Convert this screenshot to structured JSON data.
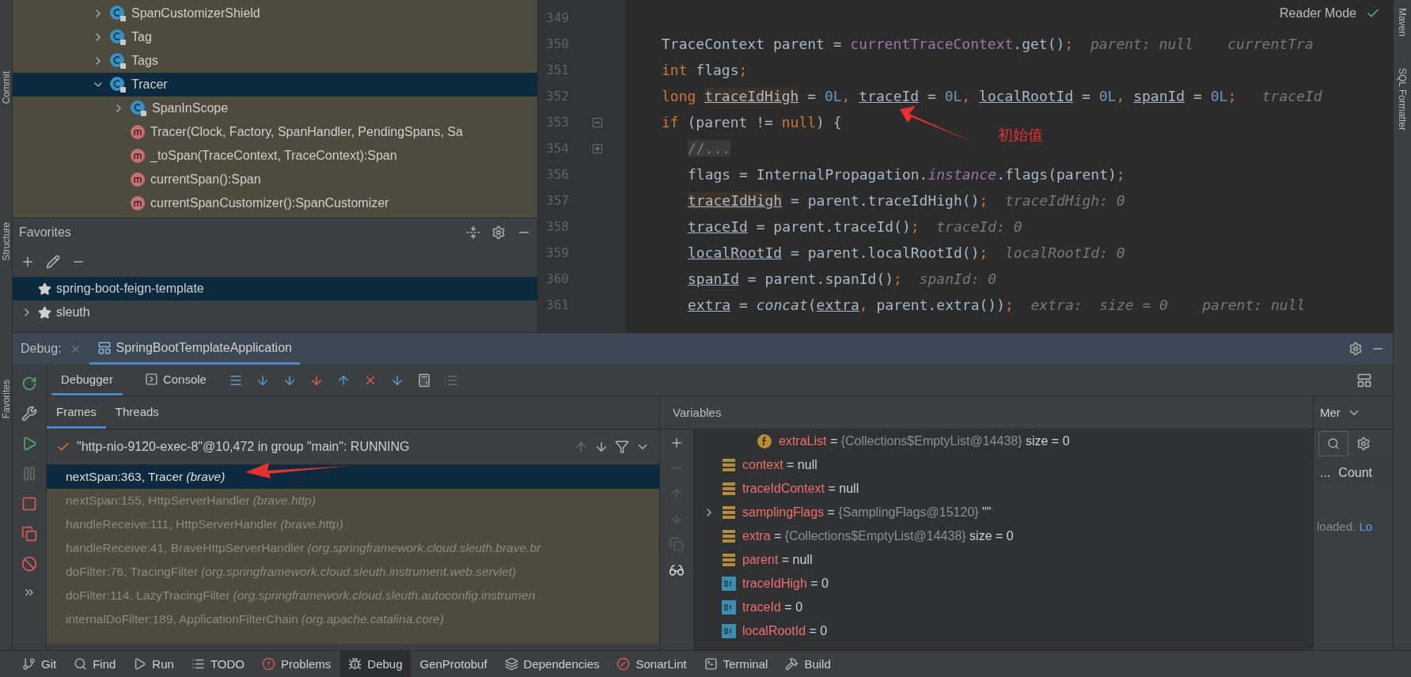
{
  "left_strip": [
    "Commit",
    "Structure",
    "Favorites"
  ],
  "right_strip": [
    "Maven",
    "SQL Formatter"
  ],
  "project_tree": [
    {
      "label": "SpanCustomizerShield",
      "kind": "class",
      "expanded": false,
      "selected": false
    },
    {
      "label": "Tag",
      "kind": "class",
      "expanded": false,
      "selected": false
    },
    {
      "label": "Tags",
      "kind": "class",
      "expanded": false,
      "selected": false
    },
    {
      "label": "Tracer",
      "kind": "class",
      "expanded": true,
      "selected": true,
      "children": [
        {
          "label": "SpanInScope",
          "kind": "class",
          "expanded": false,
          "selected": false
        },
        {
          "label": "Tracer(Clock, Factory, SpanHandler, PendingSpans, Sa",
          "kind": "method",
          "selected": false
        },
        {
          "label": "_toSpan(TraceContext, TraceContext):Span",
          "kind": "method",
          "selected": false
        },
        {
          "label": "currentSpan():Span",
          "kind": "method",
          "selected": false
        },
        {
          "label": "currentSpanCustomizer():SpanCustomizer",
          "kind": "method",
          "selected": false
        }
      ]
    }
  ],
  "favorites": {
    "title": "Favorites",
    "items": [
      {
        "label": "spring-boot-feign-template",
        "expandable": false,
        "selected": true
      },
      {
        "label": "sleuth",
        "expandable": true,
        "selected": false
      }
    ]
  },
  "editor": {
    "reader_mode": "Reader Mode",
    "annotation": "初始值",
    "lines": [
      {
        "number": "349"
      },
      {
        "number": "350",
        "tokens": [
          {
            "text": "TraceContext parent = ",
            "kind": "plain"
          },
          {
            "text": "currentTraceContext",
            "kind": "field"
          },
          {
            "text": ".get()",
            "kind": "plain"
          },
          {
            "text": ";",
            "kind": "punct"
          },
          {
            "text": "  parent: null    currentTra",
            "kind": "hint"
          }
        ]
      },
      {
        "number": "351",
        "tokens": [
          {
            "text": "int",
            "kind": "keyword"
          },
          {
            "text": " flags",
            "kind": "plain"
          },
          {
            "text": ";",
            "kind": "punct"
          }
        ]
      },
      {
        "number": "352",
        "tokens": [
          {
            "text": "long ",
            "kind": "keyword"
          },
          {
            "text": "traceIdHigh",
            "kind": "varhl"
          },
          {
            "text": " = ",
            "kind": "plain"
          },
          {
            "text": "0L",
            "kind": "number"
          },
          {
            "text": ", ",
            "kind": "punct"
          },
          {
            "text": "traceId",
            "kind": "var"
          },
          {
            "text": " = ",
            "kind": "plain"
          },
          {
            "text": "0L",
            "kind": "number"
          },
          {
            "text": ", ",
            "kind": "punct"
          },
          {
            "text": "localRootId",
            "kind": "var"
          },
          {
            "text": " = ",
            "kind": "plain"
          },
          {
            "text": "0L",
            "kind": "number"
          },
          {
            "text": ", ",
            "kind": "punct"
          },
          {
            "text": "spanId",
            "kind": "var"
          },
          {
            "text": " = ",
            "kind": "plain"
          },
          {
            "text": "0L",
            "kind": "number"
          },
          {
            "text": ";",
            "kind": "punct"
          },
          {
            "text": "   traceId",
            "kind": "hint"
          }
        ]
      },
      {
        "number": "353",
        "collapsed": false,
        "tokens": [
          {
            "text": "if",
            "kind": "keyword"
          },
          {
            "text": " (parent != ",
            "kind": "plain"
          },
          {
            "text": "null",
            "kind": "keyword"
          },
          {
            "text": ") {",
            "kind": "plain"
          }
        ]
      },
      {
        "number": "354",
        "collapsed": true,
        "inner": true,
        "tokens": [
          {
            "text": "//...",
            "kind": "folded"
          }
        ]
      },
      {
        "number": "356",
        "inner": true,
        "tokens": [
          {
            "text": "flags = InternalPropagation.",
            "kind": "plain"
          },
          {
            "text": "instance",
            "kind": "static"
          },
          {
            "text": ".flags(parent)",
            "kind": "plain"
          },
          {
            "text": ";",
            "kind": "punct"
          }
        ]
      },
      {
        "number": "357",
        "inner": true,
        "tokens": [
          {
            "text": "traceIdHigh",
            "kind": "varhl"
          },
          {
            "text": " = parent.traceIdHigh()",
            "kind": "plain"
          },
          {
            "text": ";",
            "kind": "punct"
          },
          {
            "text": "  traceIdHigh: 0",
            "kind": "hint"
          }
        ]
      },
      {
        "number": "358",
        "inner": true,
        "tokens": [
          {
            "text": "traceId",
            "kind": "var"
          },
          {
            "text": " = parent.traceId()",
            "kind": "plain"
          },
          {
            "text": ";",
            "kind": "punct"
          },
          {
            "text": "  traceId: 0",
            "kind": "hint"
          }
        ]
      },
      {
        "number": "359",
        "inner": true,
        "tokens": [
          {
            "text": "localRootId",
            "kind": "var"
          },
          {
            "text": " = parent.localRootId()",
            "kind": "plain"
          },
          {
            "text": ";",
            "kind": "punct"
          },
          {
            "text": "  localRootId: 0",
            "kind": "hint"
          }
        ]
      },
      {
        "number": "360",
        "inner": true,
        "tokens": [
          {
            "text": "spanId",
            "kind": "var"
          },
          {
            "text": " = parent.spanId()",
            "kind": "plain"
          },
          {
            "text": ";",
            "kind": "punct"
          },
          {
            "text": "  spanId: 0",
            "kind": "hint"
          }
        ]
      },
      {
        "number": "361",
        "inner": true,
        "tokens": [
          {
            "text": "extra",
            "kind": "var"
          },
          {
            "text": " = ",
            "kind": "plain"
          },
          {
            "text": "concat",
            "kind": "italic"
          },
          {
            "text": "(",
            "kind": "plain"
          },
          {
            "text": "extra",
            "kind": "var"
          },
          {
            "text": ", ",
            "kind": "punct"
          },
          {
            "text": "parent.extra())",
            "kind": "plain"
          },
          {
            "text": ";",
            "kind": "punct"
          },
          {
            "text": "  extra:  size = 0    parent: null",
            "kind": "hint"
          }
        ]
      }
    ]
  },
  "debug": {
    "label": "Debug:",
    "tab": "SpringBootTemplateApplication",
    "tool_tabs": [
      {
        "label": "Debugger",
        "selected": true
      },
      {
        "label": "Console",
        "selected": false
      }
    ],
    "frame_tabs": [
      {
        "label": "Frames",
        "selected": true
      },
      {
        "label": "Threads",
        "selected": false
      }
    ],
    "thread": "\"http-nio-9120-exec-8\"@10,472 in group \"main\": RUNNING",
    "frames": [
      {
        "method": "nextSpan:363, Tracer",
        "package": "(brave)",
        "selected": true
      },
      {
        "method": "nextSpan:155, HttpServerHandler",
        "package": "(brave.http)",
        "selected": false
      },
      {
        "method": "handleReceive:111, HttpServerHandler",
        "package": "(brave.http)",
        "selected": false
      },
      {
        "method": "handleReceive:41, BraveHttpServerHandler",
        "package": "(org.springframework.cloud.sleuth.brave.br",
        "selected": false
      },
      {
        "method": "doFilter:76, TracingFilter",
        "package": "(org.springframework.cloud.sleuth.instrument.web.servlet)",
        "selected": false
      },
      {
        "method": "doFilter:114, LazyTracingFilter",
        "package": "(org.springframework.cloud.sleuth.autoconfig.instrumen",
        "selected": false
      },
      {
        "method": "internalDoFilter:189, ApplicationFilterChain",
        "package": "(org.apache.catalina.core)",
        "selected": false
      }
    ],
    "variables_title": "Variables",
    "variables": [
      {
        "kind": "field",
        "name": "extraList",
        "sep": "=",
        "ref": "{Collections$EmptyList@14438}",
        "value": "size = 0",
        "expandable": false,
        "nested": true
      },
      {
        "kind": "object",
        "name": "context",
        "sep": "=",
        "value": "null",
        "expandable": false,
        "nested": false
      },
      {
        "kind": "object",
        "name": "traceIdContext",
        "sep": "=",
        "value": "null",
        "expandable": false,
        "nested": false
      },
      {
        "kind": "object",
        "name": "samplingFlags",
        "sep": "=",
        "ref": "{SamplingFlags@15120}",
        "value": "\"\"",
        "expandable": true,
        "nested": false
      },
      {
        "kind": "object",
        "name": "extra",
        "sep": "=",
        "ref": "{Collections$EmptyList@14438}",
        "value": "size = 0",
        "expandable": false,
        "nested": false
      },
      {
        "kind": "object",
        "name": "parent",
        "sep": "=",
        "value": "null",
        "expandable": false,
        "nested": false
      },
      {
        "kind": "primitive",
        "name": "traceIdHigh",
        "sep": "=",
        "value": "0",
        "expandable": false,
        "nested": false
      },
      {
        "kind": "primitive",
        "name": "traceId",
        "sep": "=",
        "value": "0",
        "expandable": false,
        "nested": false
      },
      {
        "kind": "primitive",
        "name": "localRootId",
        "sep": "=",
        "value": "0",
        "expandable": false,
        "nested": false
      }
    ],
    "memory": {
      "tab": "Mer",
      "column_1": "...",
      "column_2": "Count",
      "message": "loaded.",
      "link": "Lo"
    }
  },
  "bottom_bar": [
    {
      "label": "Git",
      "selected": false
    },
    {
      "label": "Find",
      "selected": false
    },
    {
      "label": "Run",
      "selected": false
    },
    {
      "label": "TODO",
      "selected": false
    },
    {
      "label": "Problems",
      "selected": false
    },
    {
      "label": "Debug",
      "selected": true
    },
    {
      "label": "GenProtobuf",
      "selected": false
    },
    {
      "label": "Dependencies",
      "selected": false
    },
    {
      "label": "SonarLint",
      "selected": false
    },
    {
      "label": "Terminal",
      "selected": false
    },
    {
      "label": "Build",
      "selected": false
    }
  ]
}
